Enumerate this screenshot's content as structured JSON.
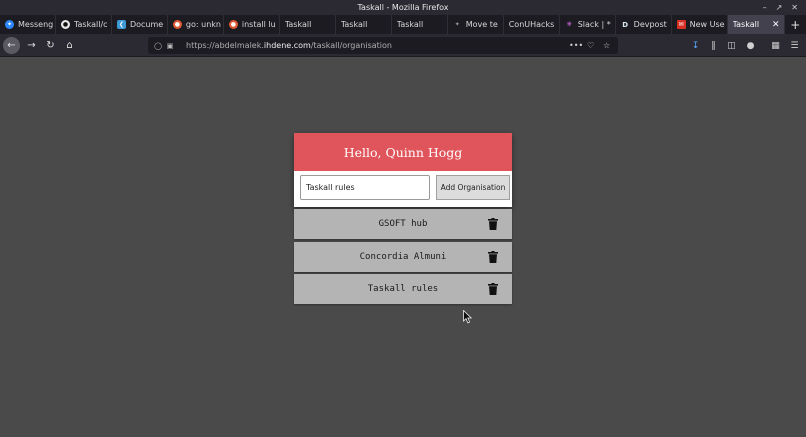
{
  "window": {
    "title": "Taskall - Mozilla Firefox"
  },
  "tabs": [
    {
      "label": "Messeng",
      "icon": "messenger-icon",
      "color": "#2d88ff"
    },
    {
      "label": "Taskall/c",
      "icon": "github-icon",
      "color": "#e8e8e8"
    },
    {
      "label": "Docume",
      "icon": "vscode-icon",
      "color": "#3c99d4"
    },
    {
      "label": "go: unkn",
      "icon": "duckduckgo-icon",
      "color": "#de5833"
    },
    {
      "label": "install lu",
      "icon": "duckduckgo-icon",
      "color": "#de5833"
    },
    {
      "label": "Taskall",
      "icon": "",
      "color": ""
    },
    {
      "label": "Taskall",
      "icon": "",
      "color": ""
    },
    {
      "label": "Taskall",
      "icon": "",
      "color": ""
    },
    {
      "label": "Move te",
      "icon": "move-icon",
      "color": "#888888"
    },
    {
      "label": "ConUHacks",
      "icon": "",
      "color": ""
    },
    {
      "label": "Slack | *",
      "icon": "slack-icon",
      "color": "#c665d8"
    },
    {
      "label": "Devpost",
      "icon": "devpost-icon",
      "color": "#1b2a3a"
    },
    {
      "label": "New Use",
      "icon": "gmail-icon",
      "color": "#d93025"
    }
  ],
  "active_tab": {
    "label": "Taskall"
  },
  "address": {
    "prefix": "https://abdelmalek.",
    "host": "ihdene.com",
    "path": "/taskall/organisation"
  },
  "app": {
    "greeting": "Hello, Quinn Hogg",
    "input_value": "Taskall rules",
    "add_button": "Add Organisation",
    "accent_color": "#e0555b",
    "organisations": [
      {
        "name": "GSOFT hub"
      },
      {
        "name": "Concordia Almuni"
      },
      {
        "name": "Taskall rules"
      }
    ]
  }
}
